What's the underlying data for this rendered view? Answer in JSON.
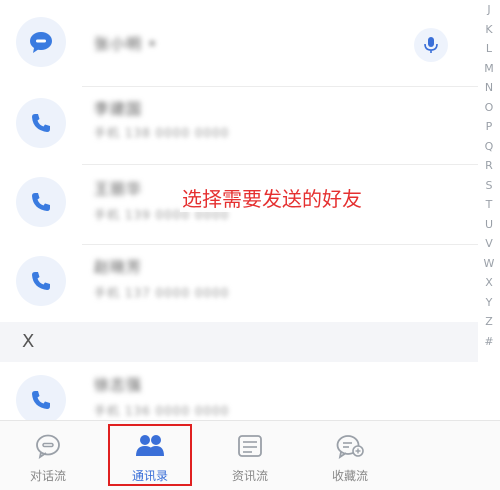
{
  "contacts": [
    {
      "name": "张小明 •",
      "sub": "",
      "icon": "message-icon"
    },
    {
      "name": "李建国",
      "sub": "手机 138 0000 0000",
      "icon": "phone-icon"
    },
    {
      "name": "王丽华",
      "sub": "手机 139 0000 0000",
      "icon": "phone-icon"
    },
    {
      "name": "赵晓芳",
      "sub": "手机 137 0000 0000",
      "icon": "phone-icon"
    },
    {
      "name": "徐志强",
      "sub": "手机 136 0000 0000",
      "icon": "phone-icon"
    }
  ],
  "section_header": "X",
  "index_letters": [
    "J",
    "K",
    "L",
    "M",
    "N",
    "O",
    "P",
    "Q",
    "R",
    "S",
    "T",
    "U",
    "V",
    "W",
    "X",
    "Y",
    "Z",
    "#"
  ],
  "annotation": "选择需要发送的好友",
  "tabs": [
    {
      "label": "对话流",
      "icon": "chat-bubble-icon",
      "active": false
    },
    {
      "label": "通讯录",
      "icon": "contacts-icon",
      "active": true
    },
    {
      "label": "资讯流",
      "icon": "news-icon",
      "active": false
    },
    {
      "label": "收藏流",
      "icon": "favorites-icon",
      "active": false
    }
  ],
  "colors": {
    "accent": "#3a6fd8",
    "highlight": "#e02020",
    "annotation": "#e53030"
  }
}
